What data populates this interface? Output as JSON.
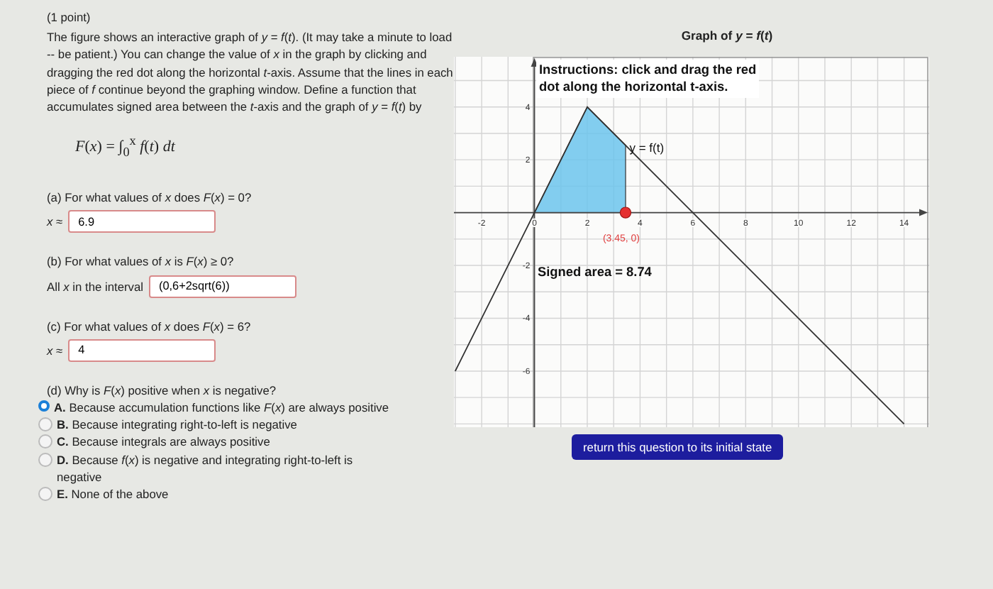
{
  "problem": {
    "points": "(1 point)",
    "intro": "The figure shows an interactive graph of *y* = *f*(*t*). (It may take a minute to load -- be patient.) You can change the value of *x* in the graph by clicking and dragging the red dot along the horizontal *t*-axis. Assume that the lines in each piece of *f* continue beyond the graphing window. Define a function that accumulates signed area between the *t*-axis and the graph of *y* = *f*(*t*) by",
    "formula": "*F*(*x*) = ∫$_{0}$$^{x}$ *f*(*t*) *dt*"
  },
  "parts": [
    {
      "question": "(a) For what values of *x* does *F*(*x*) = 0?",
      "prefix": "*x* ≈",
      "value": "6.9"
    },
    {
      "question": "(b) For what values of *x* is *F*(*x*) ≥ 0?",
      "prefix": "All *x* in the interval",
      "value": "(0,6+2sqrt(6))"
    },
    {
      "question": "(c) For what values of *x* does *F*(*x*) = 6?",
      "prefix": "*x* ≈",
      "value": "4"
    }
  ],
  "choice_question": {
    "question": "(d) Why is *F*(*x*) positive when *x* is negative?",
    "options": [
      {
        "text": "**A.** Because accumulation functions like *F*(*x*) are always positive",
        "selected": true
      },
      {
        "text": "**B.** Because integrating right-to-left is negative",
        "selected": false
      },
      {
        "text": "**C.** Because integrals are always positive",
        "selected": false
      },
      {
        "text": "**D.** Because *f*(*x*) is negative and integrating right-to-left is negative",
        "selected": false
      },
      {
        "text": "**E.** None of the above",
        "selected": false
      }
    ]
  },
  "graph": {
    "title": "Graph of *y* = *f*(*t*)",
    "instructions": [
      "Instructions: click and drag the red",
      "dot along the horizontal t-axis."
    ],
    "signed_area": "Signed area = 8.74",
    "chart_data": {
      "type": "line",
      "grid": true,
      "xlim": [
        -3.05,
        14.95
      ],
      "ylim": [
        -8.15,
        5.9
      ],
      "x": [
        -3,
        2,
        6,
        14
      ],
      "series": [
        {
          "name": "y = f(t)",
          "color": "#333333",
          "values": [
            -6,
            4,
            0,
            -8
          ]
        }
      ],
      "xticks": [
        -2,
        0,
        2,
        4,
        6,
        8,
        10,
        12,
        14
      ],
      "yticks": [
        -6,
        -4,
        -2,
        2,
        4
      ],
      "annotations": [
        {
          "x": 3.45,
          "y": 0,
          "text": "(3.45, 0)"
        }
      ]
    }
  },
  "reset_button": "return this question to its initial state"
}
